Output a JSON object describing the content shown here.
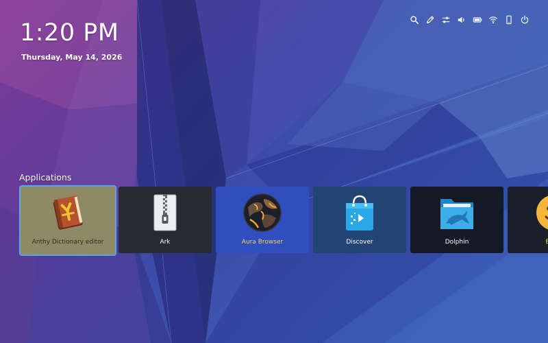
{
  "clock": {
    "time": "1:20 PM",
    "date": "Thursday, May 14, 2026"
  },
  "tray": [
    {
      "icon": "search-icon"
    },
    {
      "icon": "pencil-icon"
    },
    {
      "icon": "sliders-icon"
    },
    {
      "icon": "volume-icon"
    },
    {
      "icon": "battery-icon"
    },
    {
      "icon": "wifi-icon"
    },
    {
      "icon": "phone-icon"
    },
    {
      "icon": "power-icon"
    }
  ],
  "applications": {
    "title": "Applications",
    "items": [
      {
        "label": "Anthy Dictionary editor",
        "icon": "dictionary-book-icon",
        "bg": "#8f8a63",
        "selected": true
      },
      {
        "label": "Ark",
        "icon": "archive-zipper-icon",
        "bg": "#272a31",
        "selected": false
      },
      {
        "label": "Aura Browser",
        "icon": "aura-globe-icon",
        "bg": "#2f4fbf",
        "selected": false
      },
      {
        "label": "Discover",
        "icon": "shopping-bag-icon",
        "bg": "#234574",
        "selected": false
      },
      {
        "label": "Dolphin",
        "icon": "folder-dolphin-icon",
        "bg": "#141925",
        "selected": false
      },
      {
        "label": "Emoji",
        "icon": "emoji-face-icon",
        "bg": "#1b1f2c",
        "selected": false
      }
    ]
  },
  "colors": {
    "accent": "#5aa6e6",
    "selected_label": "#2a2a2a",
    "highlight_label": "#f2d44b"
  }
}
